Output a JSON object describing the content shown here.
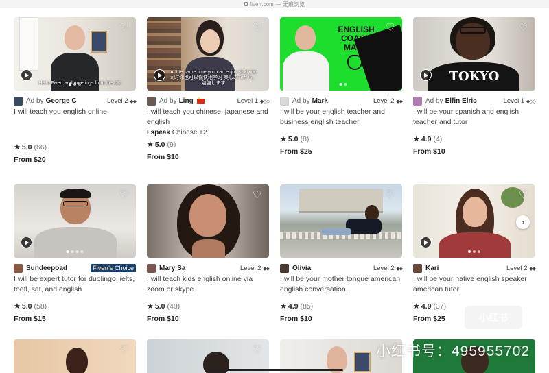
{
  "browser": {
    "address": "fiverr.com",
    "mode": "— 无痕浏览"
  },
  "colors": {
    "green_bg": "#1dde2d",
    "choice_bg": "#1a3f6b",
    "heart": "#ffffff"
  },
  "gigs": [
    {
      "ad_label": "Ad by",
      "seller": "George C",
      "level": "Level 2",
      "level_dots": "◆◆",
      "title": "I will teach you english online",
      "rating": "5.0",
      "count": "(66)",
      "price": "From $20",
      "caption": "Hello Fiverr and greetings from the UK.",
      "has_play": true
    },
    {
      "ad_label": "Ad by",
      "seller": "Ling",
      "level": "Level 1",
      "level_dots": "◆◇◇",
      "title": "I will teach you chinese, japanese and english",
      "speak_label": "I speak",
      "speak_value": "Chinese +2",
      "rating": "5.0",
      "count": "(9)",
      "price": "From $10",
      "caption": "At the same time you can enjoy studying 同时你也可以愉快地学习 楽しみながら、勉強します",
      "has_play": true
    },
    {
      "ad_label": "Ad by",
      "seller": "Mark",
      "level": "Level 2",
      "level_dots": "◆◆",
      "title": "I will be your english teacher and business english teacher",
      "rating": "5.0",
      "count": "(8)",
      "price": "From $25",
      "banner": "ENGLISH COACH MARK"
    },
    {
      "ad_label": "Ad by",
      "seller": "Elfin Elric",
      "level": "Level 1",
      "level_dots": "◆◇◇",
      "title": "I will be your spanish and english teacher and tutor",
      "rating": "4.9",
      "count": "(4)",
      "price": "From $10",
      "shirt_text": "TOKYO",
      "has_play": true
    },
    {
      "seller": "Sundeepoad",
      "badge_prefix": "Fiverr's",
      "badge": "Choice",
      "title": "I will be expert tutor for duolingo, ielts, toefl, sat, and english",
      "rating": "5.0",
      "count": "(58)",
      "price": "From $15",
      "has_play": true
    },
    {
      "seller": "Mary Sa",
      "level": "Level 2",
      "level_dots": "◆◆",
      "title": "I will teach kids english online via zoom or skype",
      "rating": "5.0",
      "count": "(40)",
      "price": "From $10"
    },
    {
      "seller": "Olivia",
      "level": "Level 2",
      "level_dots": "◆◆",
      "title": "I will be your mother tongue american english conversation...",
      "rating": "4.9",
      "count": "(85)",
      "price": "From $10"
    },
    {
      "seller": "Kari",
      "level": "Level 2",
      "level_dots": "◆◆",
      "title": "I will be your native english speaker american tutor",
      "rating": "4.9",
      "count": "(37)",
      "price": "From $25",
      "has_play": true
    }
  ],
  "watermark": {
    "text": "小红书号：495955702",
    "logo": "小红书"
  },
  "icons": {
    "heart": "heart-icon",
    "play": "play-icon",
    "star": "star-icon",
    "next": "chevron-right-icon",
    "lock": "lock-icon"
  }
}
